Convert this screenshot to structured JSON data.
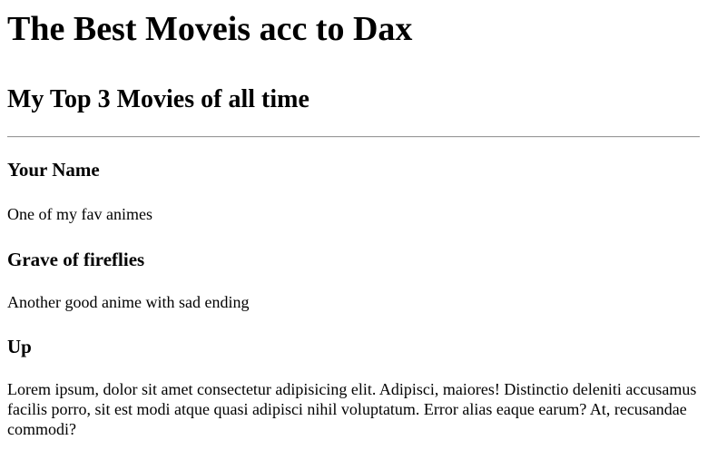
{
  "page": {
    "title": "The Best Moveis acc to Dax",
    "subtitle": "My Top 3 Movies of all time"
  },
  "movies": [
    {
      "title": "Your Name",
      "description": "One of my fav animes"
    },
    {
      "title": "Grave of fireflies",
      "description": "Another good anime with sad ending"
    },
    {
      "title": "Up",
      "description": "Lorem ipsum, dolor sit amet consectetur adipisicing elit. Adipisci, maiores! Distinctio deleniti accusamus facilis porro, sit est modi atque quasi adipisci nihil voluptatum. Error alias eaque earum? At, recusandae commodi?"
    }
  ]
}
